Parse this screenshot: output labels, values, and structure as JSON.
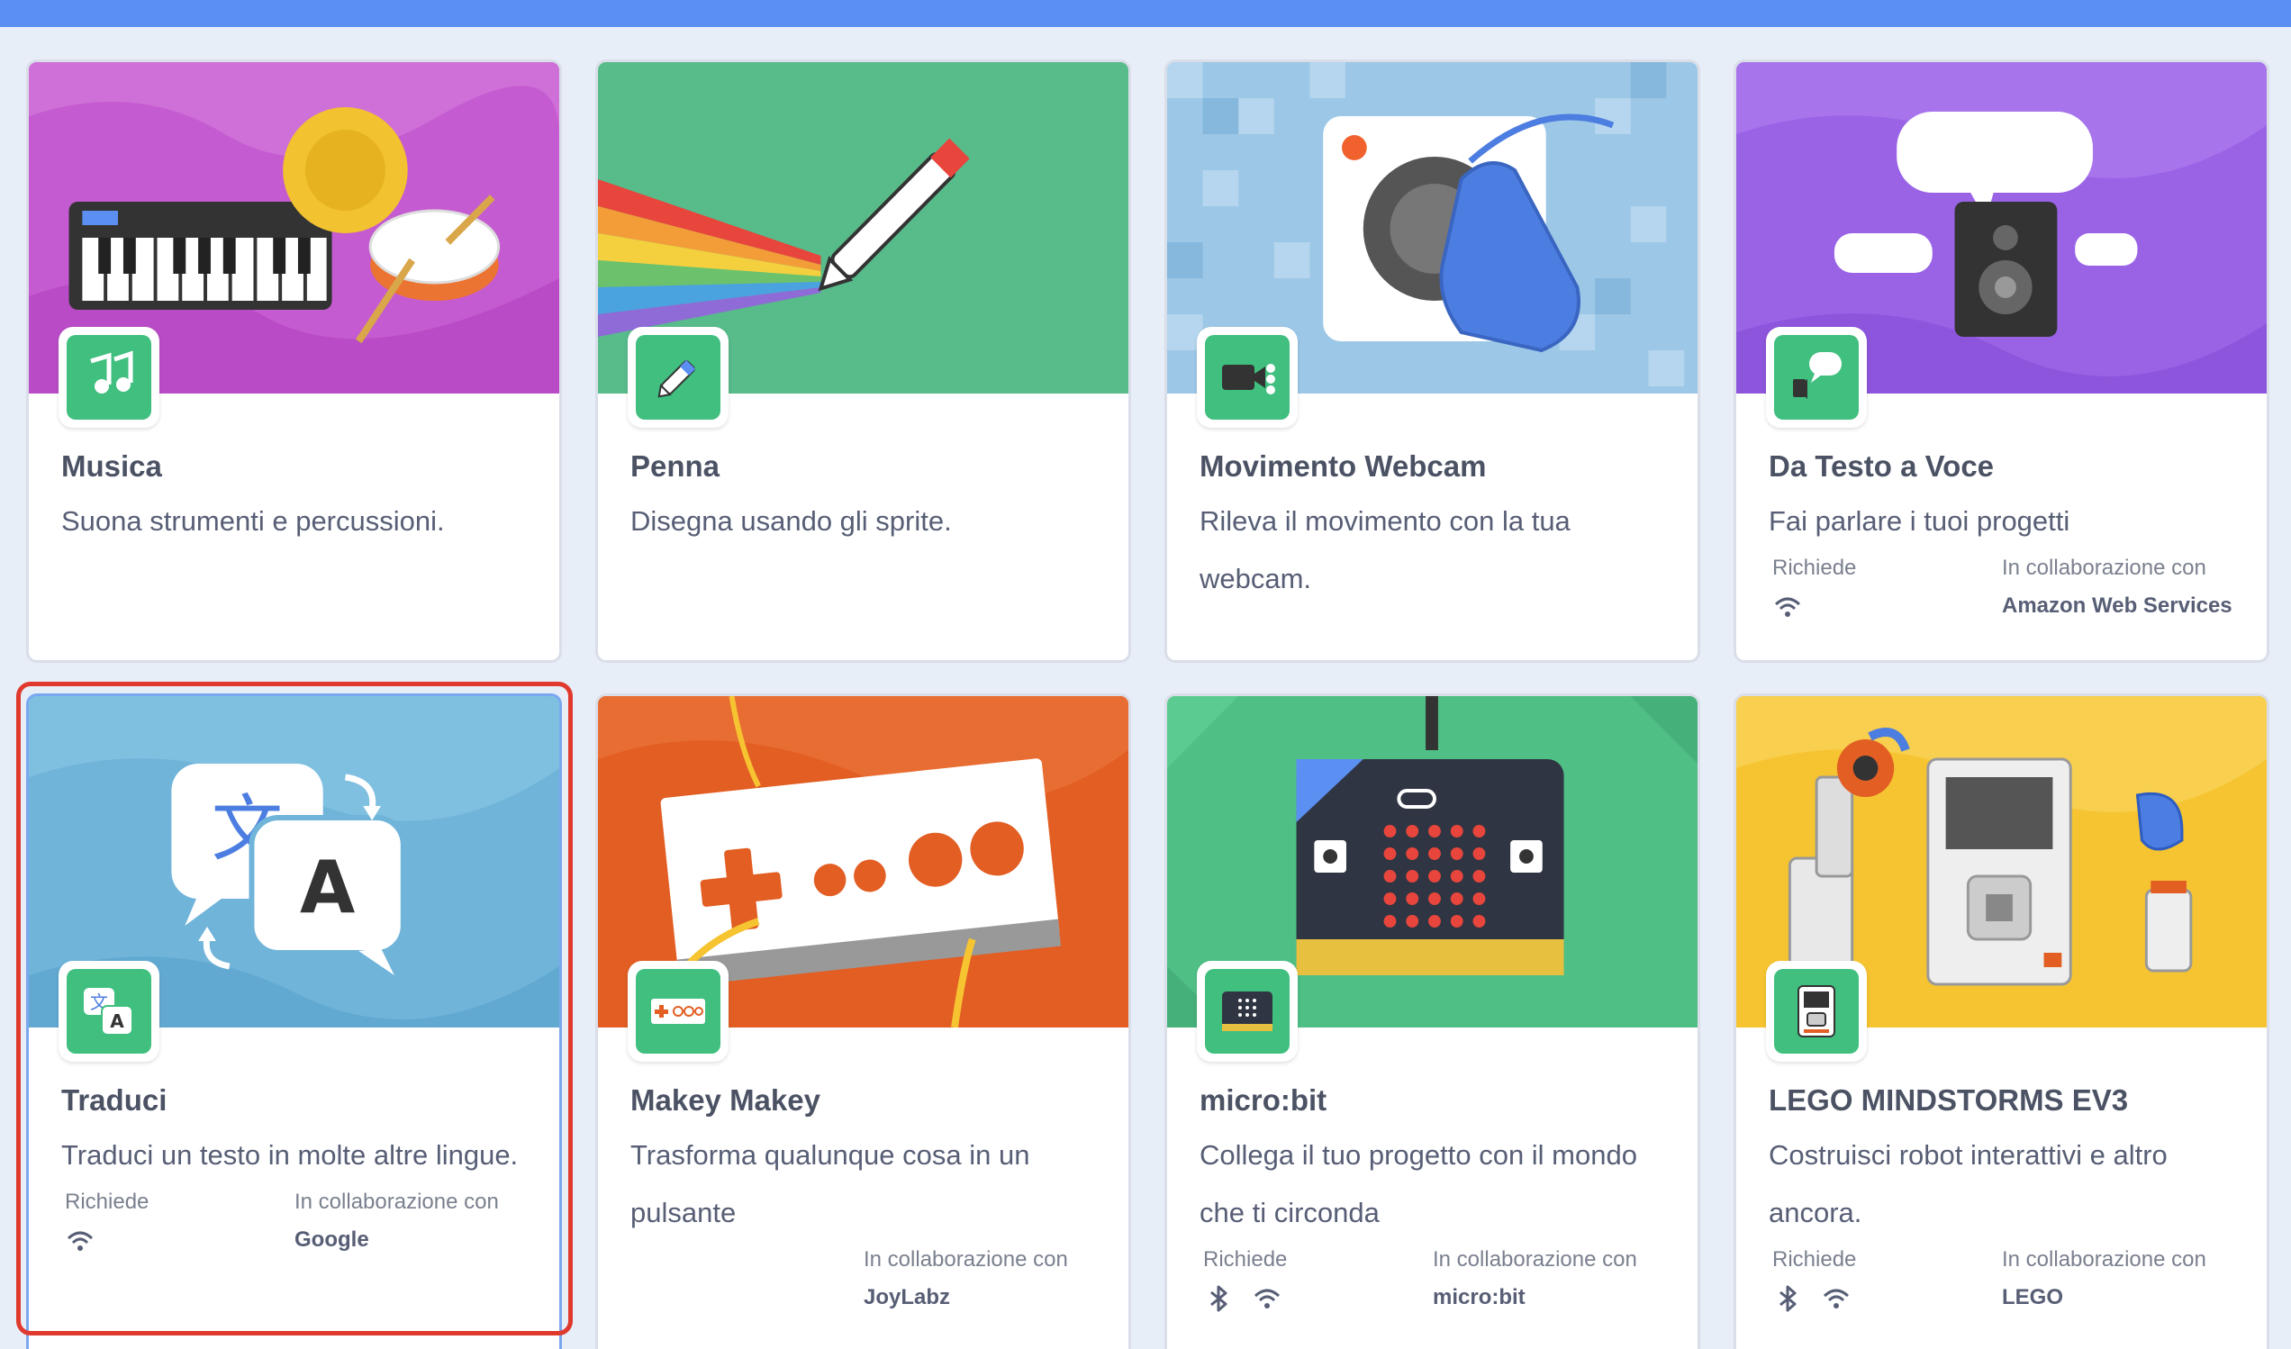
{
  "colors": {
    "topbar": "#5b8ff2",
    "page_bg": "#e8eef8",
    "badge_green": "#40bf7f",
    "selection_ring": "#e03a2e"
  },
  "extensions": [
    {
      "id": "music",
      "title": "Musica",
      "description": "Suona strumenti e percussioni.",
      "icon": "music-notes-icon",
      "banner_color": "#c55bd0"
    },
    {
      "id": "pen",
      "title": "Penna",
      "description": "Disegna usando gli sprite.",
      "icon": "pen-icon",
      "banner_color": "#58bb8a"
    },
    {
      "id": "video",
      "title": "Movimento Webcam",
      "description": "Rileva il movimento con la tua webcam.",
      "icon": "video-camera-icon",
      "banner_color": "#9cc7e6"
    },
    {
      "id": "tts",
      "title": "Da Testo a Voce",
      "description": "Fai parlare i tuoi progetti",
      "icon": "speech-bubble-icon",
      "banner_color": "#9a63e6",
      "requires_label": "Richiede",
      "requires": [
        "wifi-icon"
      ],
      "partner_label": "In collaborazione con",
      "partner": "Amazon Web Services"
    },
    {
      "id": "translate",
      "title": "Traduci",
      "description": "Traduci un testo in molte altre lingue.",
      "icon": "translate-icon",
      "banner_color": "#70b4d9",
      "requires_label": "Richiede",
      "requires": [
        "wifi-icon"
      ],
      "partner_label": "In collaborazione con",
      "partner": "Google",
      "selected": true
    },
    {
      "id": "makeymakey",
      "title": "Makey Makey",
      "description": "Trasforma qualunque cosa in un pulsante",
      "icon": "makey-board-icon",
      "banner_color": "#e25e23",
      "partner_label": "In collaborazione con",
      "partner": "JoyLabz"
    },
    {
      "id": "microbit",
      "title": "micro:bit",
      "description": "Collega il tuo progetto con il mondo che ti circonda",
      "icon": "microbit-icon",
      "banner_color": "#4fbf86",
      "requires_label": "Richiede",
      "requires": [
        "bluetooth-icon",
        "wifi-icon"
      ],
      "partner_label": "In collaborazione con",
      "partner": "micro:bit"
    },
    {
      "id": "ev3",
      "title": "LEGO MINDSTORMS EV3",
      "description": "Costruisci robot interattivi e altro ancora.",
      "icon": "ev3-brick-icon",
      "banner_color": "#f6c431",
      "requires_label": "Richiede",
      "requires": [
        "bluetooth-icon",
        "wifi-icon"
      ],
      "partner_label": "In collaborazione con",
      "partner": "LEGO"
    }
  ]
}
